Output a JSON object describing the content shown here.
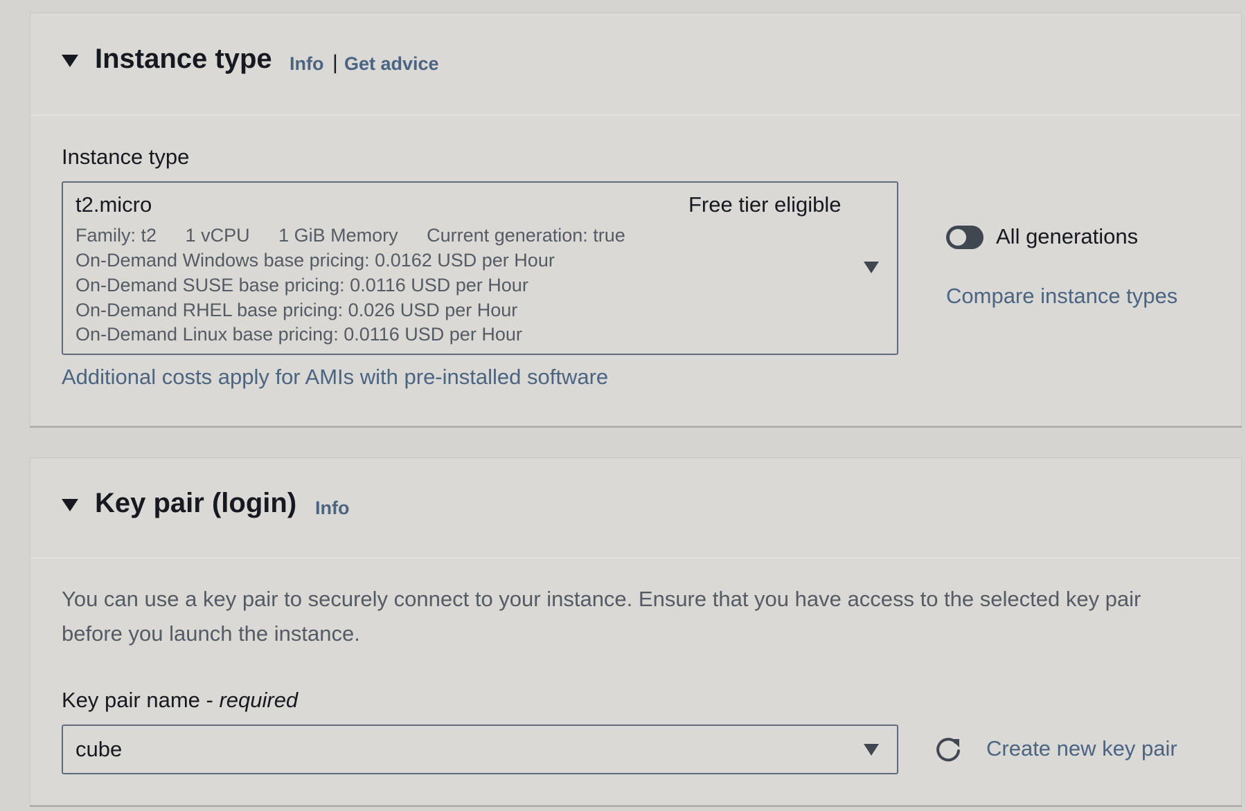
{
  "instance_type_section": {
    "title": "Instance type",
    "info_link": "Info",
    "separator": "|",
    "advice_link": "Get advice",
    "field_label": "Instance type",
    "selected": {
      "name": "t2.micro",
      "tag": "Free tier eligible",
      "family": "Family: t2",
      "vcpu": "1 vCPU",
      "memory": "1 GiB Memory",
      "generation": "Current generation: true",
      "pricing_windows": "On-Demand Windows base pricing: 0.0162 USD per Hour",
      "pricing_suse": "On-Demand SUSE base pricing: 0.0116 USD per Hour",
      "pricing_rhel": "On-Demand RHEL base pricing: 0.026 USD per Hour",
      "pricing_linux": "On-Demand Linux base pricing: 0.0116 USD per Hour"
    },
    "all_generations_label": "All generations",
    "all_generations_on": false,
    "compare_link": "Compare instance types",
    "additional_costs_link": "Additional costs apply for AMIs with pre-installed software"
  },
  "key_pair_section": {
    "title": "Key pair (login)",
    "info_link": "Info",
    "description": "You can use a key pair to securely connect to your instance. Ensure that you have access to the selected key pair before you launch the instance.",
    "field_label": "Key pair name - ",
    "field_required": "required",
    "selected_value": "cube",
    "create_link": "Create new key pair",
    "refresh_icon": "refresh-icon"
  },
  "colors": {
    "page_bg": "#d6d4d0",
    "panel_bg": "#dbd9d5",
    "link": "#4a6482",
    "text": "#16191f",
    "muted_text": "#545b64",
    "border": "#5f6b7a"
  }
}
